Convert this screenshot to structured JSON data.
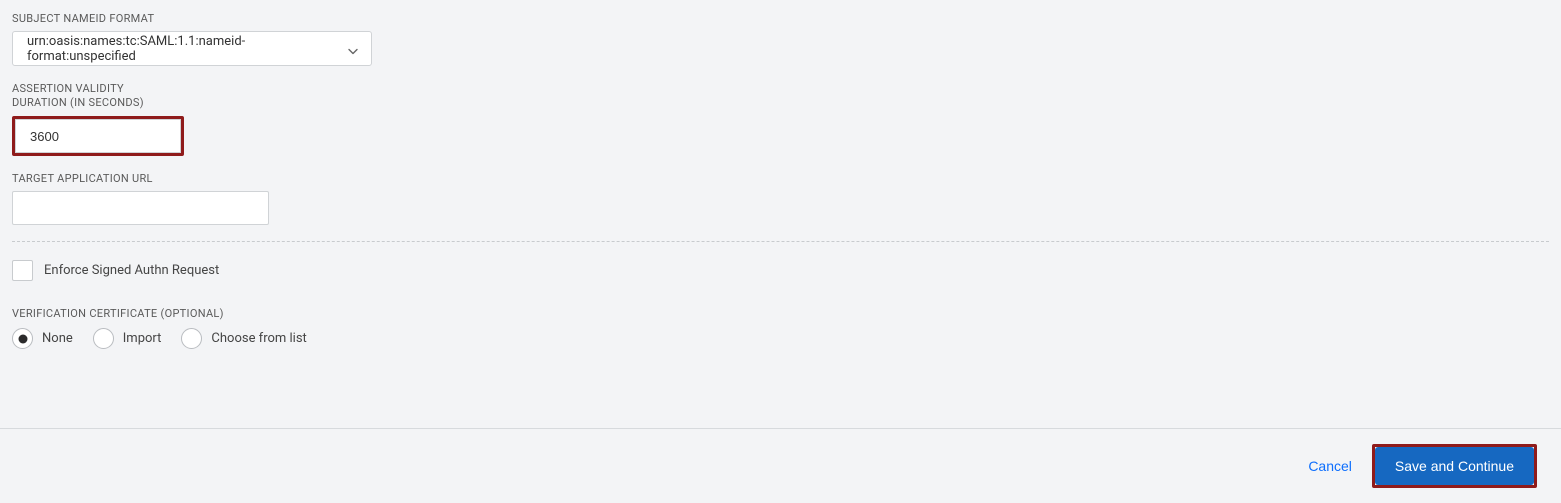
{
  "fields": {
    "subject_nameid_format": {
      "label": "SUBJECT NAMEID FORMAT",
      "value": "urn:oasis:names:tc:SAML:1.1:nameid-format:unspecified"
    },
    "assertion_validity": {
      "label_line1": "ASSERTION VALIDITY",
      "label_line2": "DURATION (IN SECONDS)",
      "value": "3600"
    },
    "target_url": {
      "label": "TARGET APPLICATION URL",
      "value": ""
    },
    "enforce_signed": {
      "label": "Enforce Signed Authn Request",
      "checked": false
    },
    "verification_cert": {
      "label": "VERIFICATION CERTIFICATE (OPTIONAL)",
      "options": {
        "none": "None",
        "import": "Import",
        "choose": "Choose from list"
      },
      "selected": "none"
    }
  },
  "footer": {
    "cancel": "Cancel",
    "save": "Save and Continue"
  }
}
